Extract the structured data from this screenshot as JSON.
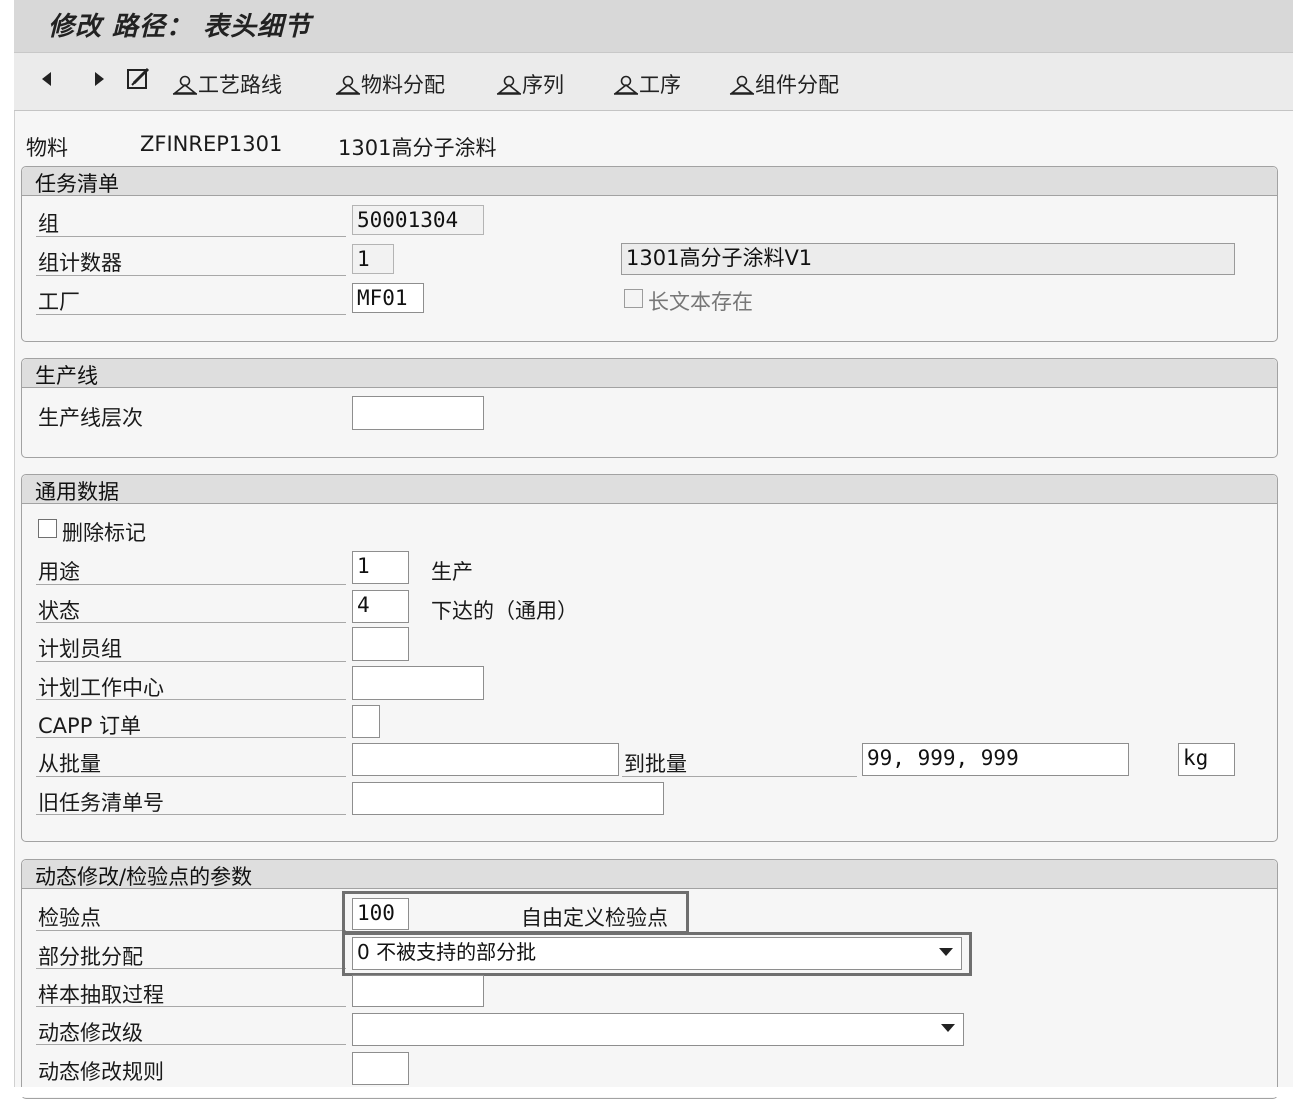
{
  "title": "修改 路径： 表头细节",
  "toolbar": {
    "routing": "工艺路线",
    "material_assignment": "物料分配",
    "sequence": "序列",
    "operation": "工序",
    "component_assignment": "组件分配"
  },
  "material": {
    "label": "物料",
    "code": "ZFINREP1301",
    "name": "1301高分子涂料"
  },
  "task_list": {
    "header": "任务清单",
    "group_label": "组",
    "group_value": "50001304",
    "counter_label": "组计数器",
    "counter_value": "1",
    "description_value": "1301高分子涂料V1",
    "plant_label": "工厂",
    "plant_value": "MF01",
    "long_text_label": "长文本存在"
  },
  "production_line": {
    "header": "生产线",
    "level_label": "生产线层次",
    "level_value": ""
  },
  "general": {
    "header": "通用数据",
    "delete_flag_label": "删除标记",
    "usage_label": "用途",
    "usage_value": "1",
    "usage_text": "生产",
    "status_label": "状态",
    "status_value": "4",
    "status_text": "下达的（通用）",
    "planner_group_label": "计划员组",
    "planner_group_value": "",
    "work_center_label": "计划工作中心",
    "work_center_value": "",
    "capp_label": "CAPP 订单",
    "capp_value": "",
    "from_lot_label": "从批量",
    "from_lot_value": "",
    "to_lot_label": "到批量",
    "to_lot_value": "99, 999, 999",
    "unit_value": "kg",
    "old_task_list_label": "旧任务清单号",
    "old_task_list_value": ""
  },
  "dynamic": {
    "header": "动态修改/检验点的参数",
    "inspection_point_label": "检验点",
    "inspection_point_value": "100",
    "inspection_point_text": "自由定义检验点",
    "partial_lot_label": "部分批分配",
    "partial_lot_value": "0 不被支持的部分批",
    "sample_label": "样本抽取过程",
    "sample_value": "",
    "mod_level_label": "动态修改级",
    "mod_level_value": "",
    "mod_rule_label": "动态修改规则",
    "mod_rule_value": ""
  }
}
